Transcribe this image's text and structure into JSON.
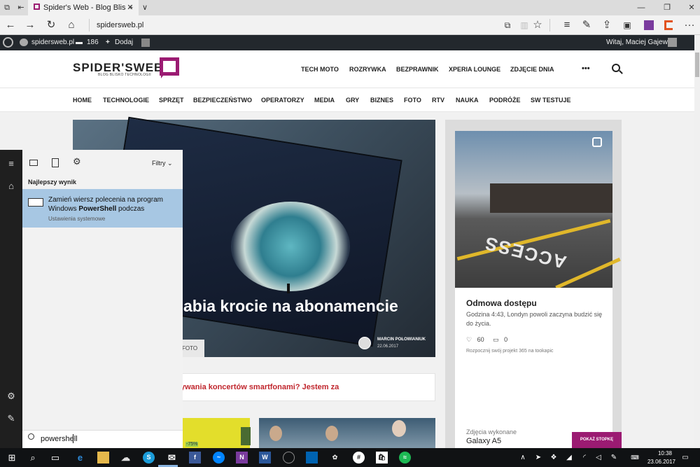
{
  "browser": {
    "tab_title": "Spider's Web - Blog Blis",
    "new_tab": "+",
    "tab_menu": "∨",
    "address": "spidersweb.pl",
    "minimize": "—",
    "restore": "❐",
    "close": "✕",
    "more": "···"
  },
  "wp_admin_bar": {
    "site_name": "spidersweb.pl",
    "comments_count": "186",
    "add_new": "Dodaj",
    "greeting": "Witaj, Maciej Gajewski"
  },
  "site": {
    "logo_text": "SPIDER'SWEB",
    "logo_sub": "BLOG BLISKO TECHNOLOGII",
    "top_nav": [
      "TECH MOTO",
      "ROZRYWKA",
      "BEZPRAWNIK",
      "XPERIA LOUNGE",
      "ZDJĘCIE DNIA"
    ],
    "more_dots": "•••",
    "categories": [
      "HOME",
      "TECHNOLOGIE",
      "SPRZĘT",
      "BEZPIECZEŃSTWO",
      "OPERATORZY",
      "MEDIA",
      "GRY",
      "BIZNES",
      "FOTO",
      "RTV",
      "NAUKA",
      "PODRÓŻE",
      "SW TESTUJE"
    ],
    "accent_color": "#9b1b72"
  },
  "hero": {
    "title": "abia krocie na abonamencie",
    "author": "MARCIN POŁOWIANIUK",
    "date": "22.06.2017",
    "tag": "FOTO"
  },
  "headline": {
    "text": "ywania koncertów smartfonami? Jestem za"
  },
  "thumb1_badge": "-75%",
  "side_card": {
    "title": "Odmowa dostępu",
    "description": "Godzina 4:43, Londyn powoli zaczyna budzić się do życia.",
    "likes": "60",
    "comments": "0",
    "promo": "Rozpocznij swój projekt 365 na tookapic",
    "caption": "Zdjęcia wykonane",
    "device": "Galaxy A5",
    "button": "POKAŻ STOPKĘ",
    "stamp": "ACCESS"
  },
  "search": {
    "filter_label": "Filtry",
    "best_result_header": "Najlepszy wynik",
    "result_line1": "Zamień wiersz polecenia na program",
    "result_line2_pre": "Windows ",
    "result_line2_bold": "PowerShell",
    "result_line2_post": " podczas",
    "result_subtitle": "Ustawienia systemowe",
    "query": "powershell"
  },
  "taskbar": {
    "time": "10:38",
    "date": "23.06.2017"
  }
}
